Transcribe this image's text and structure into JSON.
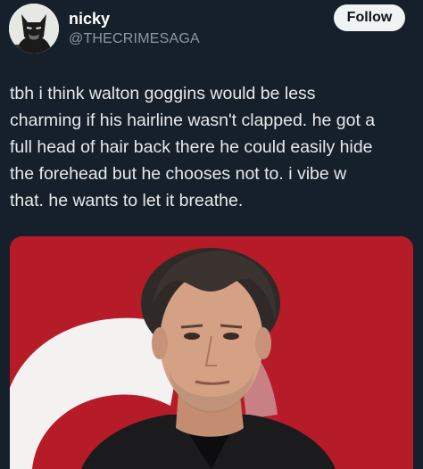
{
  "tweet": {
    "author": {
      "display_name": "nicky",
      "handle": "@THECRIMESAGA",
      "avatar_icon": "batman-avatar-icon"
    },
    "follow_label": "Follow",
    "text_lines": [
      "tbh i think walton goggins would be less",
      "charming if his hairline wasn't clapped. he got a",
      "full head of hair back there he could easily hide",
      "the forehead but he chooses not to. i vibe w",
      "that. he wants to let it breathe."
    ]
  },
  "colors": {
    "background": "#15202b",
    "text": "#e7e9ea",
    "secondary_text": "#8b98a5",
    "follow_button_bg": "#eff3f4",
    "photo_backdrop": "#b51c27"
  }
}
